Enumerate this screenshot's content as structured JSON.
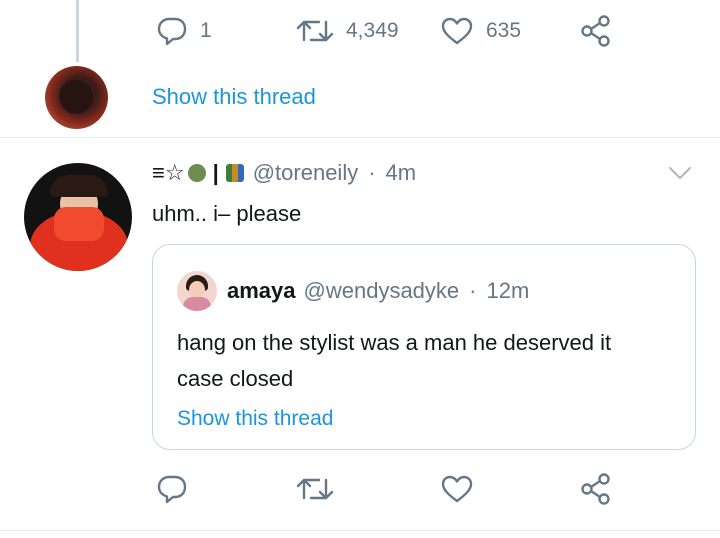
{
  "top_tweet": {
    "reply_count": "1",
    "retweet_count": "4,349",
    "like_count": "635",
    "show_thread": "Show this thread"
  },
  "tweet": {
    "display_name_prefix": "≡☆",
    "display_name_separator": "|",
    "handle": "@toreneily",
    "separator": "·",
    "time": "4m",
    "text": "uhm.. i– please"
  },
  "quote": {
    "name": "amaya",
    "handle": "@wendysadyke",
    "separator": "·",
    "time": "12m",
    "text_line1": "hang on the stylist was a man he deserved it",
    "text_line2": "case closed",
    "show_thread": "Show this thread"
  },
  "icons": {
    "reply": "reply-icon",
    "retweet": "retweet-icon",
    "like": "heart-icon",
    "share": "share-icon",
    "more": "chevron-down-icon"
  },
  "colors": {
    "link": "#1b95e0",
    "icon_gray": "#657786",
    "border": "#ccd6dd"
  }
}
